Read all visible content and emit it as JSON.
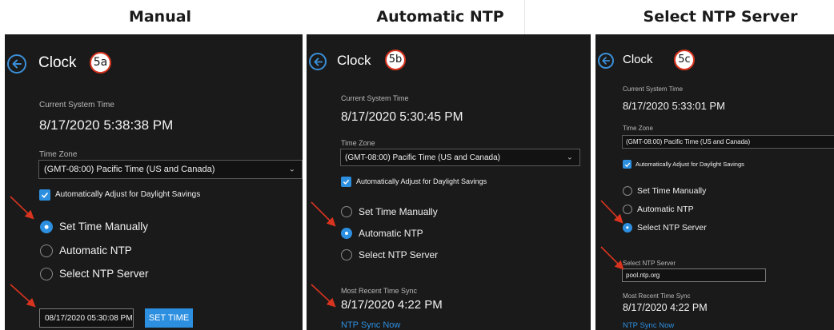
{
  "columns": {
    "manual": "Manual",
    "auto": "Automatic NTP",
    "select": "Select NTP Server"
  },
  "panel_a": {
    "title": "Clock",
    "step": "5a",
    "current_time_label": "Current System Time",
    "current_time": "8/17/2020 5:38:38 PM",
    "time_zone_label": "Time Zone",
    "time_zone": "(GMT-08:00) Pacific Time (US and Canada)",
    "dst_label": "Automatically Adjust for Daylight Savings",
    "options": [
      "Set Time Manually",
      "Automatic NTP",
      "Select NTP Server"
    ],
    "selected": "Set Time Manually",
    "datetime_value": "08/17/2020 05:30:08 PM",
    "set_time_button": "SET TIME"
  },
  "panel_b": {
    "title": "Clock",
    "step": "5b",
    "current_time_label": "Current System Time",
    "current_time": "8/17/2020 5:30:45 PM",
    "time_zone_label": "Time Zone",
    "time_zone": "(GMT-08:00) Pacific Time (US and Canada)",
    "dst_label": "Automatically Adjust for Daylight Savings",
    "options": [
      "Set Time Manually",
      "Automatic NTP",
      "Select NTP Server"
    ],
    "selected": "Automatic NTP",
    "recent_sync_label": "Most Recent Time Sync",
    "recent_sync": "8/17/2020 4:22 PM",
    "sync_now": "NTP Sync Now"
  },
  "panel_c": {
    "title": "Clock",
    "step": "5c",
    "current_time_label": "Current System Time",
    "current_time": "8/17/2020 5:33:01 PM",
    "time_zone_label": "Time Zone",
    "time_zone": "(GMT-08:00) Pacific Time (US and Canada)",
    "dst_label": "Automatically Adjust for Daylight Savings",
    "options": [
      "Set Time Manually",
      "Automatic NTP",
      "Select NTP Server"
    ],
    "selected": "Select NTP Server",
    "ntp_server_label": "Select NTP Server",
    "ntp_server": "pool.ntp.org",
    "recent_sync_label": "Most Recent Time Sync",
    "recent_sync": "8/17/2020 4:22 PM",
    "sync_now": "NTP Sync Now"
  },
  "colors": {
    "panel_bg": "#1a1a1a",
    "accent": "#2d8fe0",
    "annotation_red": "#d9341f"
  },
  "icons": [
    "back-arrow-icon",
    "checkmark-icon",
    "chevron-down-icon",
    "annotation-arrow"
  ]
}
